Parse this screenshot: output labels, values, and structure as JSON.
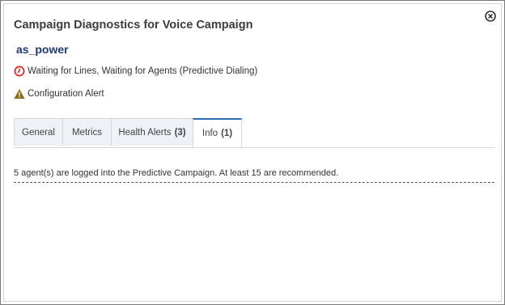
{
  "dialog": {
    "title": "Campaign Diagnostics for Voice Campaign",
    "close_icon": "close-circle-icon"
  },
  "campaign": {
    "name": "as_power"
  },
  "status": {
    "waiting_text": "Waiting for Lines, Waiting for Agents (Predictive Dialing)",
    "waiting_icon": "clock-icon",
    "waiting_color": "#d9261c",
    "alert_text": "Configuration Alert",
    "alert_icon": "warning-triangle-icon",
    "alert_color": "#8a6d1c"
  },
  "tabs": [
    {
      "label": "General",
      "count": ""
    },
    {
      "label": "Metrics",
      "count": ""
    },
    {
      "label": "Health Alerts",
      "count": "(3)"
    },
    {
      "label": "Info",
      "count": "(1)",
      "active": true
    }
  ],
  "info": {
    "message": "5 agent(s) are logged into the Predictive Campaign. At least 15 are recommended."
  },
  "colors": {
    "accent": "#2e6db4",
    "campaign_name": "#1f3a6e",
    "tab_bg": "#eef1f5"
  }
}
